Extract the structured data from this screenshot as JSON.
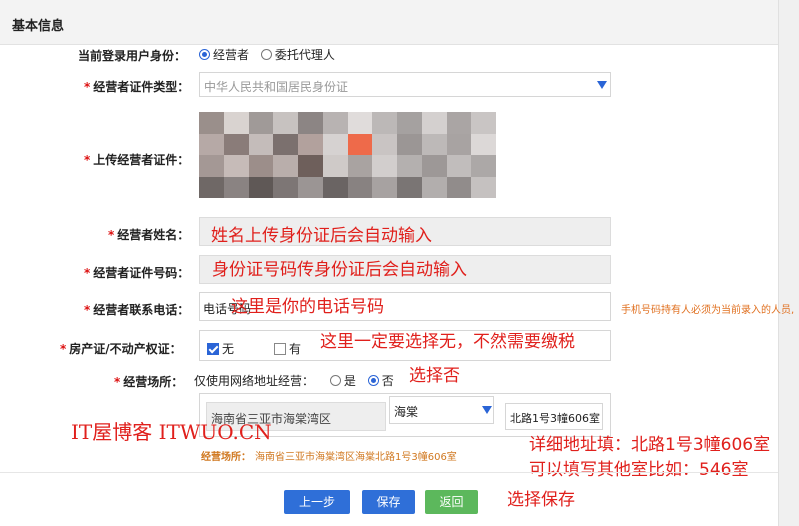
{
  "header": {
    "title": "基本信息"
  },
  "identity": {
    "label": "当前登录用户身份：",
    "options": [
      "经营者",
      "委托代理人"
    ],
    "selected": "经营者"
  },
  "cert_type": {
    "label": "经营者证件类型：",
    "value": "中华人民共和国居民身份证"
  },
  "upload": {
    "label": "上传经营者证件："
  },
  "name": {
    "label": "经营者姓名："
  },
  "cert_no": {
    "label": "经营者证件号码："
  },
  "phone": {
    "label": "经营者联系电话：",
    "value": "电话号码",
    "hint": "手机号码持有人必须为当前录入的人员,"
  },
  "property": {
    "label": "房产证/不动产权证：",
    "options": [
      "无",
      "有"
    ],
    "checked": "无"
  },
  "venue": {
    "label": "经营场所：",
    "online_label": "仅使用网络地址经营：",
    "online_options": [
      "是",
      "否"
    ],
    "online_selected": "否",
    "region": "海南省三亚市海棠湾区",
    "town": "海棠",
    "detail": "北路1号3幢606室",
    "summary_label": "经营场所：",
    "summary_value": "海南省三亚市海棠湾区海棠北路1号3幢606室"
  },
  "buttons": {
    "prev": "上一步",
    "save": "保存",
    "back": "返回"
  },
  "annotations": {
    "name_note": "姓名上传身份证后会自动输入",
    "id_note": "身份证号码传身份证后会自动输入",
    "phone_note": "这里是你的电话号码",
    "property_note": "这里一定要选择无，不然需要缴税",
    "online_note": "选择否",
    "address_note1": "详细地址填：北路1号3幢606室",
    "address_note2": "可以填写其他室比如：546室",
    "save_note": "选择保存"
  },
  "watermark": "IT屋博客 ITWUO.CN",
  "colors": {
    "accent": "#2a64d6",
    "annotation": "#e0201c",
    "watermark": "#e0201c",
    "save_button": "#5cb85c",
    "required": "#dd1111"
  }
}
